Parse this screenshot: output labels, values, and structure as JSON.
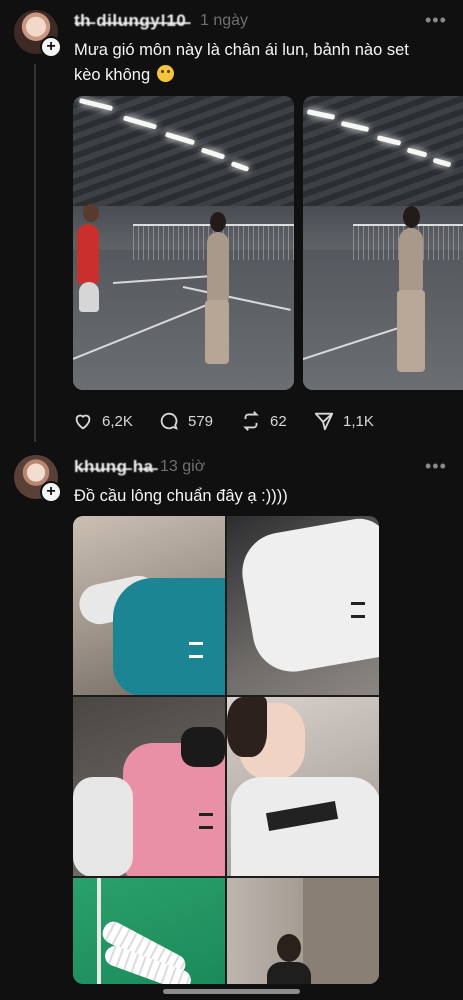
{
  "post1": {
    "username": "t̶h̶ d̶i̶l̶u̶n̶g̶y̶!̶1̶0̶",
    "time": "1 ngày",
    "more": "•••",
    "text_line1": "Mưa gió môn này là chân ái lun, bảnh nào set",
    "text_line2": "kèo không",
    "emoji": "hushed-face",
    "stats": {
      "likes": "6,2K",
      "comments": "579",
      "reposts": "62",
      "shares": "1,1K"
    }
  },
  "post2": {
    "username": "k̶h̶u̶n̶g̶ h̶a̶",
    "time": "13 giờ",
    "more": "•••",
    "text": "Đồ cầu lông chuẩn đây ạ :))))"
  },
  "colors": {
    "background": "#101010",
    "text": "#f3f5f7",
    "muted": "#6f6f6f",
    "divider": "#333333"
  }
}
